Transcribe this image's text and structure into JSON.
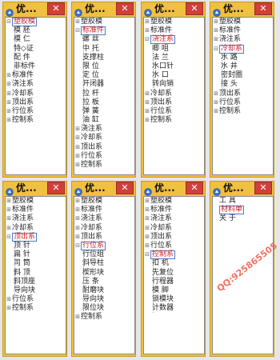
{
  "watermark": "QQ:925865505",
  "windows": [
    {
      "title": "优...",
      "close": "✕",
      "rows": [
        {
          "text": "塑胶模",
          "type": "parent",
          "open": true,
          "selected": true
        },
        {
          "text": "模 胚",
          "type": "child"
        },
        {
          "text": "模 仁",
          "type": "child"
        },
        {
          "text": "特◇证",
          "type": "child"
        },
        {
          "text": "配 件",
          "type": "child"
        },
        {
          "text": "非标件",
          "type": "child"
        },
        {
          "text": "标准件",
          "type": "parent"
        },
        {
          "text": "浇注系",
          "type": "parent"
        },
        {
          "text": "冷却系",
          "type": "parent"
        },
        {
          "text": "顶出系",
          "type": "parent"
        },
        {
          "text": "行位系",
          "type": "parent"
        },
        {
          "text": "控制系",
          "type": "parent"
        }
      ]
    },
    {
      "title": "优...",
      "close": "✕",
      "rows": [
        {
          "text": "塑胶模",
          "type": "parent"
        },
        {
          "text": "标准件",
          "type": "parent",
          "open": true,
          "selected": true
        },
        {
          "text": "螺 丝",
          "type": "child"
        },
        {
          "text": "中 托",
          "type": "child"
        },
        {
          "text": "支撑柱",
          "type": "child"
        },
        {
          "text": "限 位",
          "type": "child"
        },
        {
          "text": "定 位",
          "type": "child"
        },
        {
          "text": "开闭器",
          "type": "child"
        },
        {
          "text": "拉 杆",
          "type": "child"
        },
        {
          "text": "拉 板",
          "type": "child"
        },
        {
          "text": "弹 簧",
          "type": "child"
        },
        {
          "text": "油 缸",
          "type": "child"
        },
        {
          "text": "浇注系",
          "type": "parent"
        },
        {
          "text": "冷却系",
          "type": "parent"
        },
        {
          "text": "顶出系",
          "type": "parent"
        },
        {
          "text": "行位系",
          "type": "parent"
        },
        {
          "text": "控制系",
          "type": "parent"
        }
      ]
    },
    {
      "title": "优...",
      "close": "✕",
      "rows": [
        {
          "text": "塑胶模",
          "type": "parent"
        },
        {
          "text": "标准件",
          "type": "parent"
        },
        {
          "text": "浇注系",
          "type": "parent",
          "open": true,
          "selected": true
        },
        {
          "text": "唧 咀",
          "type": "child"
        },
        {
          "text": "法 兰",
          "type": "child"
        },
        {
          "text": "水口针",
          "type": "child"
        },
        {
          "text": "水 口",
          "type": "child"
        },
        {
          "text": "转向销",
          "type": "child"
        },
        {
          "text": "冷却系",
          "type": "parent"
        },
        {
          "text": "顶出系",
          "type": "parent"
        },
        {
          "text": "行位系",
          "type": "parent"
        },
        {
          "text": "控制系",
          "type": "parent"
        }
      ]
    },
    {
      "title": "优...",
      "close": "✕",
      "rows": [
        {
          "text": "塑胶模",
          "type": "parent"
        },
        {
          "text": "标准件",
          "type": "parent"
        },
        {
          "text": "浇注系",
          "type": "parent"
        },
        {
          "text": "冷却系",
          "type": "parent",
          "open": true,
          "selected": true
        },
        {
          "text": "水 路",
          "type": "child"
        },
        {
          "text": "水 井",
          "type": "child"
        },
        {
          "text": "密封圈",
          "type": "child"
        },
        {
          "text": "接 头",
          "type": "child"
        },
        {
          "text": "顶出系",
          "type": "parent"
        },
        {
          "text": "行位系",
          "type": "parent"
        },
        {
          "text": "控制系",
          "type": "parent"
        }
      ]
    },
    {
      "title": "优...",
      "close": "✕",
      "rows": [
        {
          "text": "塑胶模",
          "type": "parent"
        },
        {
          "text": "标准件",
          "type": "parent"
        },
        {
          "text": "浇注系",
          "type": "parent"
        },
        {
          "text": "冷却系",
          "type": "parent"
        },
        {
          "text": "顶出系",
          "type": "parent",
          "open": true,
          "selected": true
        },
        {
          "text": "顶 针",
          "type": "child"
        },
        {
          "text": "扁 针",
          "type": "child"
        },
        {
          "text": "司 筒",
          "type": "child"
        },
        {
          "text": "斜 顶",
          "type": "child"
        },
        {
          "text": "斜顶座",
          "type": "child"
        },
        {
          "text": "导向块",
          "type": "child"
        },
        {
          "text": "行位系",
          "type": "parent"
        },
        {
          "text": "控制系",
          "type": "parent"
        }
      ]
    },
    {
      "title": "优...",
      "close": "✕",
      "rows": [
        {
          "text": "塑胶模",
          "type": "parent"
        },
        {
          "text": "标准件",
          "type": "parent"
        },
        {
          "text": "浇注系",
          "type": "parent"
        },
        {
          "text": "冷却系",
          "type": "parent"
        },
        {
          "text": "顶出系",
          "type": "parent"
        },
        {
          "text": "行位系",
          "type": "parent",
          "open": true,
          "selected": true
        },
        {
          "text": "行位组",
          "type": "child"
        },
        {
          "text": "斜导柱",
          "type": "child"
        },
        {
          "text": "楔形块",
          "type": "child"
        },
        {
          "text": "压 条",
          "type": "child"
        },
        {
          "text": "耐磨块",
          "type": "child"
        },
        {
          "text": "导向块",
          "type": "child"
        },
        {
          "text": "限位块",
          "type": "child"
        },
        {
          "text": "控制系",
          "type": "parent"
        }
      ]
    },
    {
      "title": "优...",
      "close": "✕",
      "rows": [
        {
          "text": "塑胶模",
          "type": "parent"
        },
        {
          "text": "标准件",
          "type": "parent"
        },
        {
          "text": "浇注系",
          "type": "parent"
        },
        {
          "text": "冷却系",
          "type": "parent"
        },
        {
          "text": "顶出系",
          "type": "parent"
        },
        {
          "text": "行位系",
          "type": "parent"
        },
        {
          "text": "控制系",
          "type": "parent",
          "open": true,
          "selected": true
        },
        {
          "text": "扣 机",
          "type": "child"
        },
        {
          "text": "先复位",
          "type": "child"
        },
        {
          "text": "行程器",
          "type": "child"
        },
        {
          "text": "模 脚",
          "type": "child"
        },
        {
          "text": "锁模块",
          "type": "child"
        },
        {
          "text": "计数器",
          "type": "child"
        }
      ]
    },
    {
      "title": "优...",
      "close": "✕",
      "rows": [
        {
          "text": "工 具",
          "type": "plain"
        },
        {
          "text": "材料单",
          "type": "plain",
          "selected": true
        },
        {
          "text": "关 于",
          "type": "plain"
        }
      ]
    }
  ]
}
